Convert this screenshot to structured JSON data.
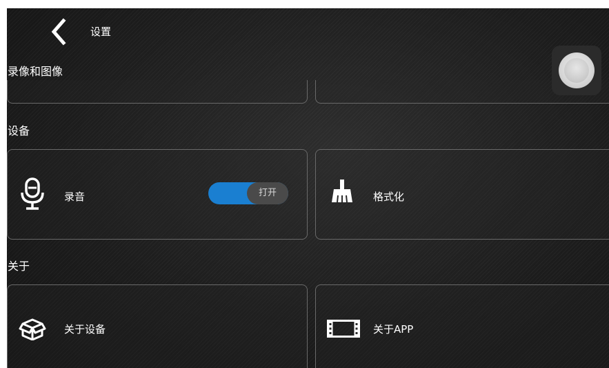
{
  "header": {
    "title": "设置"
  },
  "sections": [
    {
      "title": "录像和图像"
    },
    {
      "title": "设备"
    },
    {
      "title": "关于"
    }
  ],
  "device": {
    "recording": {
      "label": "录音",
      "toggle_state": "打开",
      "enabled": true
    },
    "format": {
      "label": "格式化"
    }
  },
  "about": {
    "device": {
      "label": "关于设备"
    },
    "app": {
      "label": "关于APP"
    }
  },
  "icons": {
    "back": "chevron-left-icon",
    "microphone": "microphone-icon",
    "broom": "broom-icon",
    "box": "box-icon",
    "film": "film-icon",
    "record": "record-button-icon"
  },
  "colors": {
    "accent": "#1a7fd0",
    "background": "#1f1f1f",
    "card_border": "#6a6a6a"
  }
}
